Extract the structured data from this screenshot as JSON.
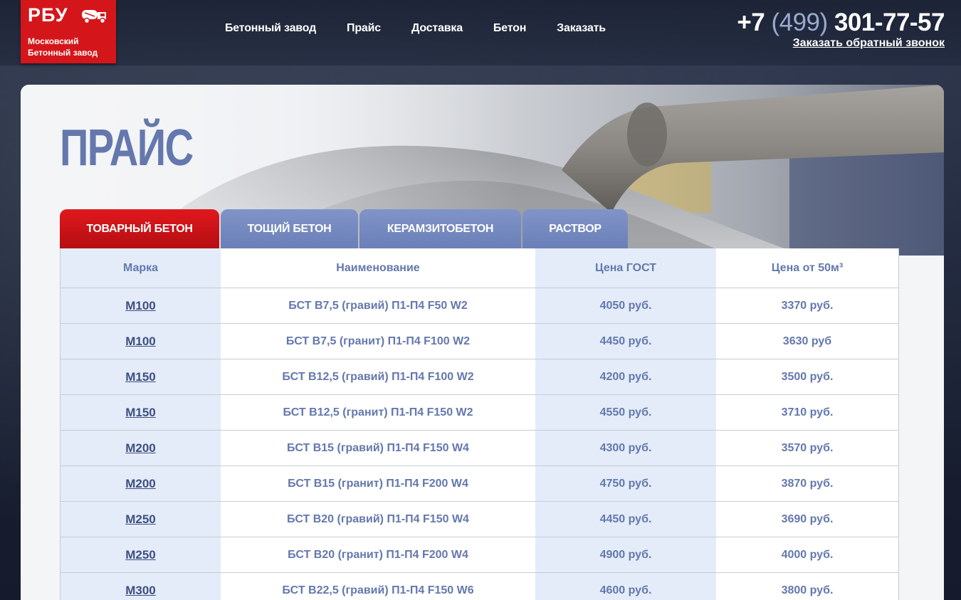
{
  "header": {
    "logo_abbr": "РБУ",
    "logo_sub_line1": "Московский",
    "logo_sub_line2": "Бетонный завод",
    "nav": [
      "Бетонный завод",
      "Прайс",
      "Доставка",
      "Бетон",
      "Заказать"
    ],
    "phone_prefix": "+7",
    "phone_code": "(499)",
    "phone_number": "301-77-57",
    "callback_label": "Заказать обратный звонок"
  },
  "page": {
    "title": "ПРАЙС"
  },
  "tabs": [
    {
      "label": "Товарный бетон",
      "active": true
    },
    {
      "label": "Тощий бетон",
      "active": false
    },
    {
      "label": "Керамзитобетон",
      "active": false
    },
    {
      "label": "Раствор",
      "active": false
    }
  ],
  "table": {
    "headers": [
      "Марка",
      "Наименование",
      "Цена ГОСТ",
      "Цена от 50м³"
    ],
    "rows": [
      [
        "М100",
        "БСТ В7,5 (гравий) П1-П4 F50 W2",
        "4050 руб.",
        "3370 руб."
      ],
      [
        "М100",
        "БСТ В7,5 (гранит) П1-П4 F100 W2",
        "4450 руб.",
        "3630 руб"
      ],
      [
        "М150",
        "БСТ В12,5 (гравий) П1-П4 F100 W2",
        "4200 руб.",
        "3500 руб."
      ],
      [
        "М150",
        "БСТ В12,5 (гранит) П1-П4 F150 W2",
        "4550 руб.",
        "3710 руб."
      ],
      [
        "М200",
        "БСТ В15 (гравий) П1-П4 F150 W4",
        "4300 руб.",
        "3570 руб."
      ],
      [
        "М200",
        "БСТ В15 (гранит) П1-П4 F200 W4",
        "4750 руб.",
        "3870 руб."
      ],
      [
        "М250",
        "БСТ В20 (гравий) П1-П4 F150 W4",
        "4450 руб.",
        "3690 руб."
      ],
      [
        "М250",
        "БСТ В20 (гранит) П1-П4 F200 W4",
        "4900 руб.",
        "4000 руб."
      ],
      [
        "М300",
        "БСТ В22,5 (гравий) П1-П4 F150 W6",
        "4600 руб.",
        "3800 руб."
      ]
    ]
  },
  "colors": {
    "brand_red": "#d4161b",
    "accent_blue": "#6478ad",
    "tab_blue": "#7a8ec4",
    "cell_light_blue": "#e3ecf8"
  }
}
